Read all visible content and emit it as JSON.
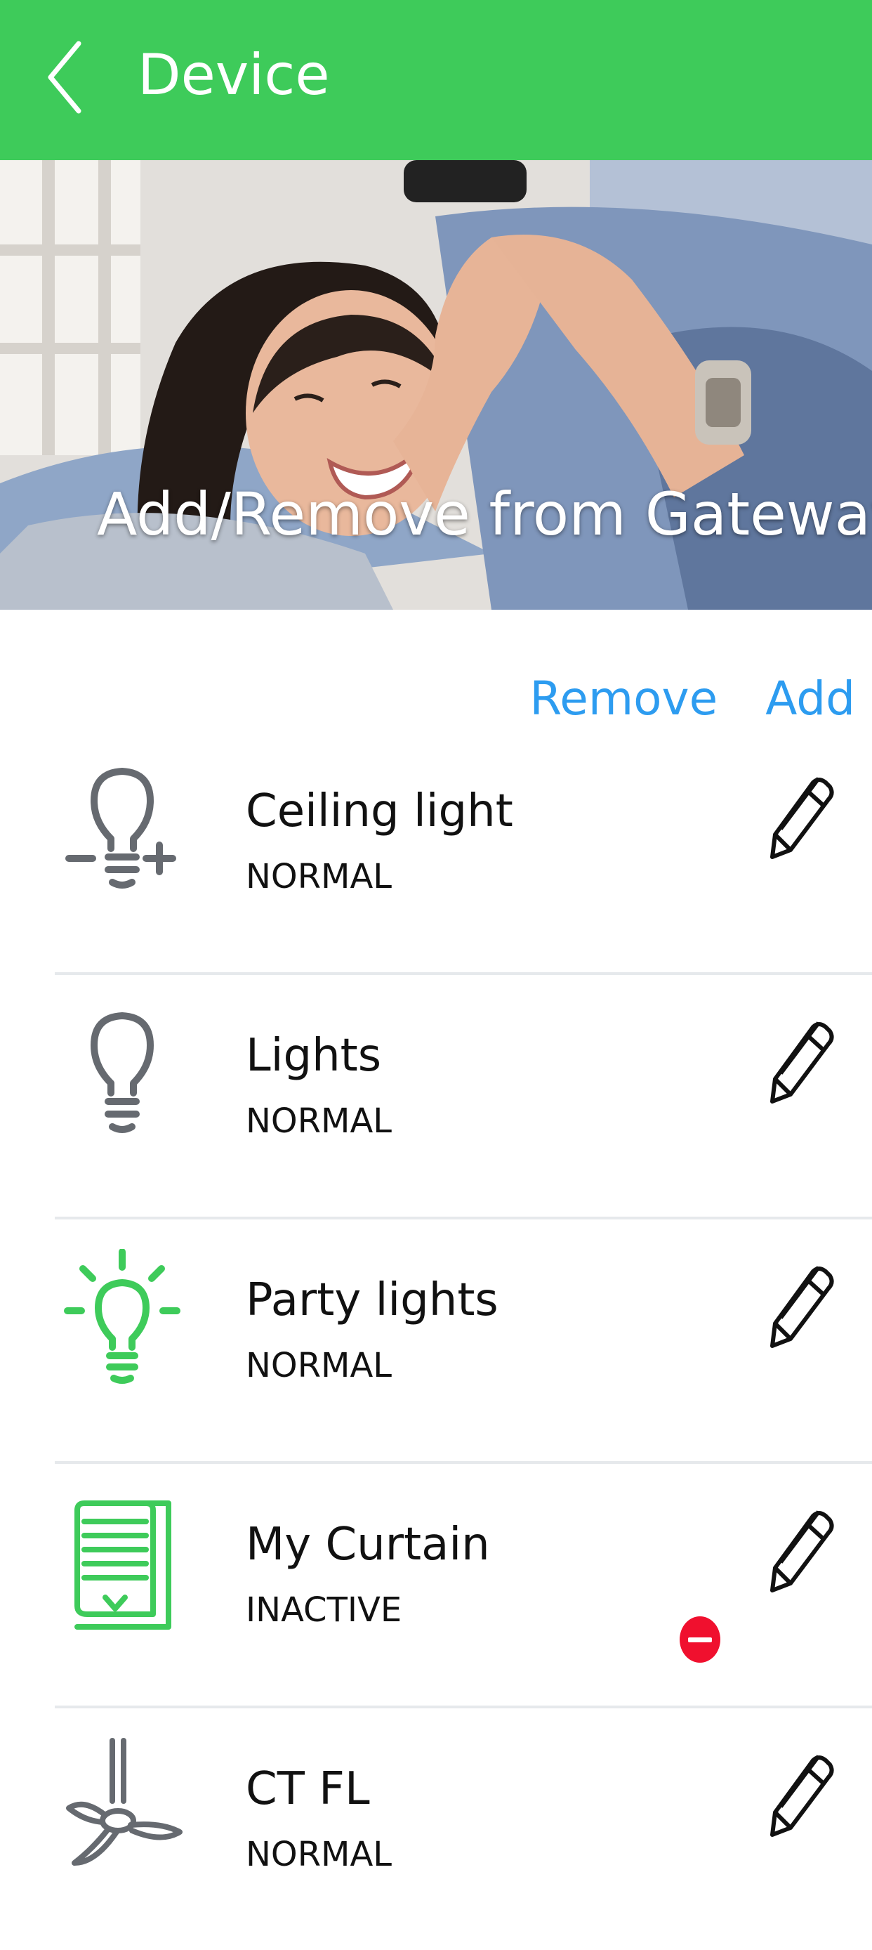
{
  "header": {
    "title": "Device",
    "back_icon": "chevron-left-icon",
    "background_color": "#3ecb5a"
  },
  "hero": {
    "caption": "Add/Remove from Gateway"
  },
  "actions": {
    "remove_label": "Remove",
    "add_label": "Add",
    "link_color": "#2d9cf0"
  },
  "devices": [
    {
      "name": "Ceiling light",
      "status": "NORMAL",
      "icon": "dimmable-bulb-icon"
    },
    {
      "name": "Lights",
      "status": "NORMAL",
      "icon": "bulb-icon"
    },
    {
      "name": "Party lights",
      "status": "NORMAL",
      "icon": "bulb-on-icon"
    },
    {
      "name": "My Curtain",
      "status": "INACTIVE",
      "icon": "curtain-icon"
    },
    {
      "name": "CT FL",
      "status": "NORMAL",
      "icon": "ceiling-fan-icon"
    }
  ],
  "colors": {
    "active_icon": "#3ecb5a",
    "inactive_icon": "#666a70",
    "remove_badge": "#f0102e"
  }
}
